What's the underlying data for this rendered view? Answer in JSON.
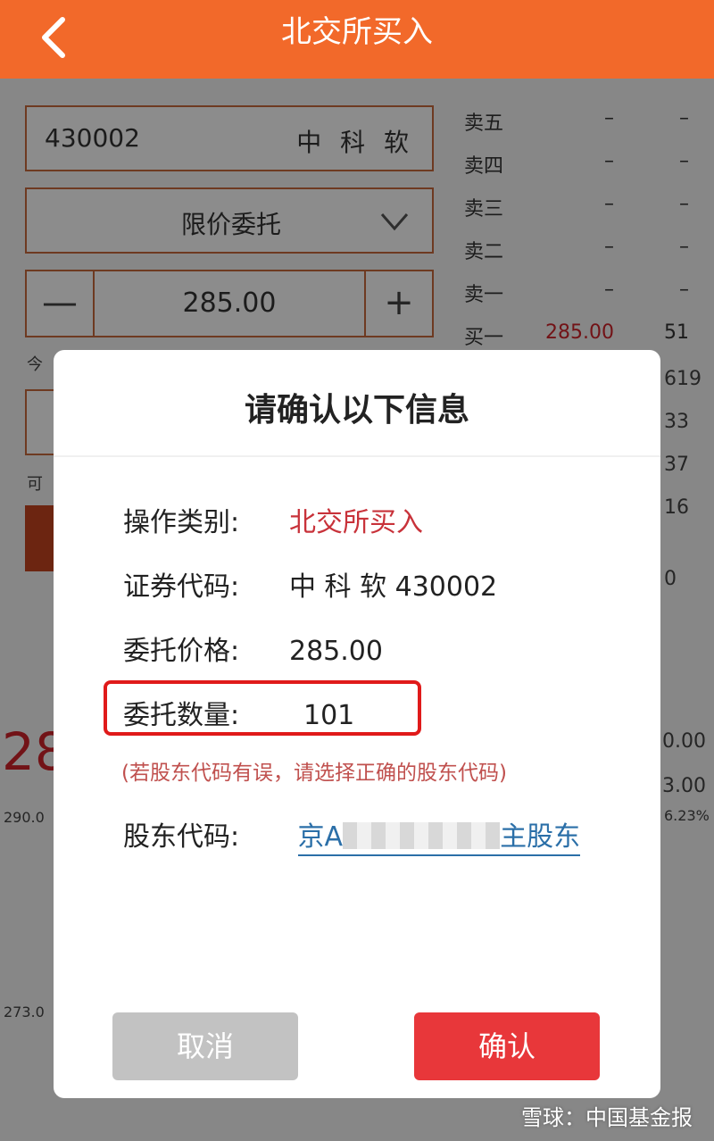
{
  "header": {
    "title": "北交所买入"
  },
  "form": {
    "code": "430002",
    "name": "中 科 软",
    "order_type": "限价委托",
    "price": "285.00",
    "minus": "—",
    "plus": "+",
    "today_stub": "今",
    "avail_stub": "可"
  },
  "order_book": [
    {
      "label": "卖五",
      "price": "–",
      "vol": "–"
    },
    {
      "label": "卖四",
      "price": "–",
      "vol": "–"
    },
    {
      "label": "卖三",
      "price": "–",
      "vol": "–"
    },
    {
      "label": "卖二",
      "price": "–",
      "vol": "–"
    },
    {
      "label": "卖一",
      "price": "–",
      "vol": "–"
    },
    {
      "label": "买一",
      "price": "285.00",
      "vol": "51"
    }
  ],
  "background": {
    "big_price": "28",
    "price_290": "290.0",
    "price_273": "273.0",
    "right_vals": [
      "619",
      "33",
      "37",
      "16",
      "0",
      "0.00",
      "3.00",
      "6.23%"
    ]
  },
  "dialog": {
    "title": "请确认以下信息",
    "rows": [
      {
        "key": "操作类别:",
        "value": "北交所买入"
      },
      {
        "key": "证券代码:",
        "value": "中 科 软 430002"
      },
      {
        "key": "委托价格:",
        "value": "285.00"
      },
      {
        "key": "委托数量:",
        "value": "101"
      }
    ],
    "hint": "(若股东代码有误，请选择正确的股东代码)",
    "account_key": "股东代码:",
    "account_prefix": "京A",
    "account_suffix": "主股东",
    "cancel_label": "取消",
    "confirm_label": "确认"
  },
  "watermark": "雪球：中国基金报",
  "colors": {
    "header": "#f2692a",
    "confirm": "#e8373a",
    "cancel": "#c2c2c2",
    "highlight": "#e01a1a"
  }
}
